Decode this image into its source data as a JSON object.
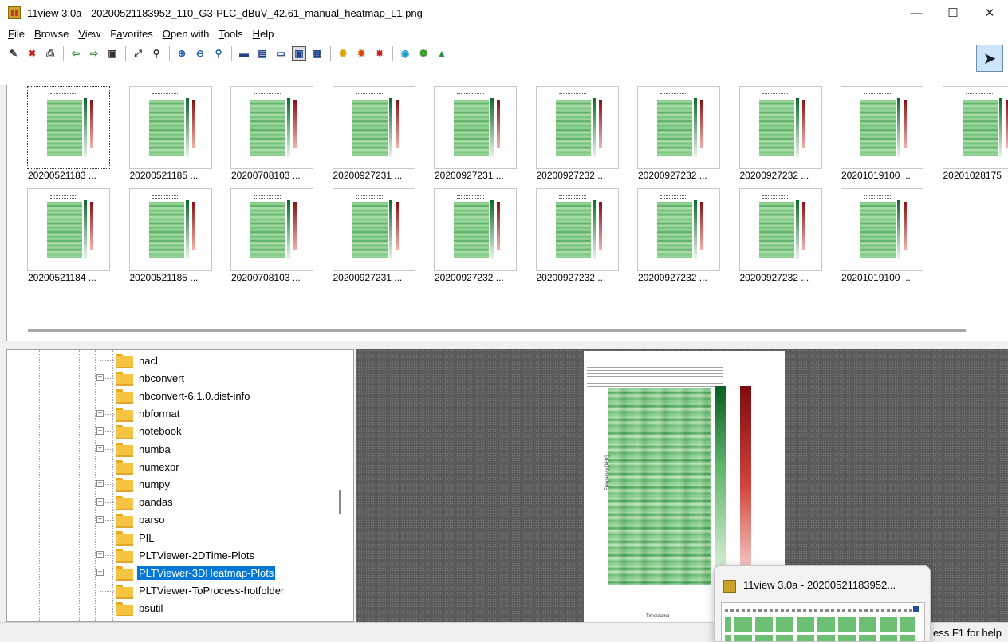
{
  "window": {
    "title": "11view 3.0a - 20200521183952_110_G3-PLC_dBuV_42.61_manual_heatmap_L1.png",
    "controls": {
      "minimize": "—",
      "maximize": "☐",
      "close": "✕"
    }
  },
  "menu": [
    {
      "key": "F",
      "rest": "ile"
    },
    {
      "key": "B",
      "rest": "rowse"
    },
    {
      "key": "V",
      "rest": "iew"
    },
    {
      "pre": "F",
      "key": "a",
      "rest": "vorites"
    },
    {
      "key": "O",
      "rest": "pen with"
    },
    {
      "key": "T",
      "rest": "ools"
    },
    {
      "key": "H",
      "rest": "elp"
    }
  ],
  "toolbar": {
    "buttons": [
      {
        "icon": "edit-icon",
        "glyph": "✎",
        "color": "#333333"
      },
      {
        "icon": "delete-icon",
        "glyph": "✖",
        "color": "#cc1f1f"
      },
      {
        "icon": "print-icon",
        "glyph": "⎙",
        "color": "#333333"
      },
      {
        "sep": true
      },
      {
        "icon": "back-arrow-icon",
        "glyph": "⇦",
        "color": "#2e8b2e"
      },
      {
        "icon": "forward-arrow-icon",
        "glyph": "⇨",
        "color": "#2e8b2e"
      },
      {
        "icon": "slideshow-icon",
        "glyph": "▣",
        "color": "#333333"
      },
      {
        "sep": true
      },
      {
        "icon": "fullscreen-icon",
        "glyph": "⤢",
        "color": "#333333"
      },
      {
        "icon": "zoom-fit-icon",
        "glyph": "⚲",
        "color": "#333333"
      },
      {
        "sep": true
      },
      {
        "icon": "zoom-in-icon",
        "glyph": "⊕",
        "color": "#1d5fb4"
      },
      {
        "icon": "zoom-out-icon",
        "glyph": "⊖",
        "color": "#1d5fb4"
      },
      {
        "icon": "zoom-actual-icon",
        "glyph": "⚲",
        "color": "#1d5fb4"
      },
      {
        "sep": true
      },
      {
        "icon": "layout-single-icon",
        "glyph": "▬",
        "color": "#1f3f8f"
      },
      {
        "icon": "layout-vertical-icon",
        "glyph": "▤",
        "color": "#1f3f8f"
      },
      {
        "icon": "layout-horizontal-icon",
        "glyph": "▭",
        "color": "#1f3f8f"
      },
      {
        "icon": "layout-split-icon",
        "glyph": "▣",
        "color": "#1f3f8f",
        "pressed": true
      },
      {
        "icon": "layout-print-icon",
        "glyph": "▦",
        "color": "#1f3f8f"
      },
      {
        "sep": true
      },
      {
        "icon": "brightness-icon",
        "glyph": "✺",
        "color": "#d9a400"
      },
      {
        "icon": "contrast-icon",
        "glyph": "✹",
        "color": "#d64b00"
      },
      {
        "icon": "color-reset-icon",
        "glyph": "✸",
        "color": "#c22020"
      },
      {
        "sep": true
      },
      {
        "icon": "settings-icon",
        "glyph": "◉",
        "color": "#1b9bd1"
      },
      {
        "icon": "plugins-icon",
        "glyph": "❁",
        "color": "#3a9b2a"
      },
      {
        "icon": "wallpaper-icon",
        "glyph": "▲",
        "color": "#2f8f3f"
      }
    ],
    "bird_glyph": "➤"
  },
  "thumbnails": [
    {
      "label": "20200521183 ...",
      "selected": true
    },
    {
      "label": "20200521185 ..."
    },
    {
      "label": "20200708103 ..."
    },
    {
      "label": "20200927231 ..."
    },
    {
      "label": "20200927231 ..."
    },
    {
      "label": "20200927232 ..."
    },
    {
      "label": "20200927232 ..."
    },
    {
      "label": "20200927232 ..."
    },
    {
      "label": "20201019100 ..."
    },
    {
      "label": "20201028175"
    },
    {
      "label": "20200521184 ..."
    },
    {
      "label": "20200521185 ..."
    },
    {
      "label": "20200708103 ..."
    },
    {
      "label": "20200927231 ..."
    },
    {
      "label": "20200927232 ..."
    },
    {
      "label": "20200927232 ..."
    },
    {
      "label": "20200927232 ..."
    },
    {
      "label": "20200927232 ..."
    },
    {
      "label": "20201019100 ..."
    }
  ],
  "tree": [
    {
      "label": "nacl",
      "expander": false
    },
    {
      "label": "nbconvert",
      "expander": true
    },
    {
      "label": "nbconvert-6.1.0.dist-info",
      "expander": false
    },
    {
      "label": "nbformat",
      "expander": true
    },
    {
      "label": "notebook",
      "expander": true
    },
    {
      "label": "numba",
      "expander": true
    },
    {
      "label": "numexpr",
      "expander": false
    },
    {
      "label": "numpy",
      "expander": true
    },
    {
      "label": "pandas",
      "expander": true
    },
    {
      "label": "parso",
      "expander": true
    },
    {
      "label": "PIL",
      "expander": false
    },
    {
      "label": "PLTViewer-2DTime-Plots",
      "expander": true
    },
    {
      "label": "PLTViewer-3DHeatmap-Plots",
      "expander": true,
      "selected": true
    },
    {
      "label": "PLTViewer-ToProcess-hotfolder",
      "expander": false
    },
    {
      "label": "psutil",
      "expander": false
    }
  ],
  "preview": {
    "ylabel": "Frequency [kHz]",
    "xlabel": "Timestamp"
  },
  "status": {
    "help": "ess F1 for help"
  },
  "taskbar_popup": {
    "title": "11view 3.0a - 20200521183952..."
  }
}
